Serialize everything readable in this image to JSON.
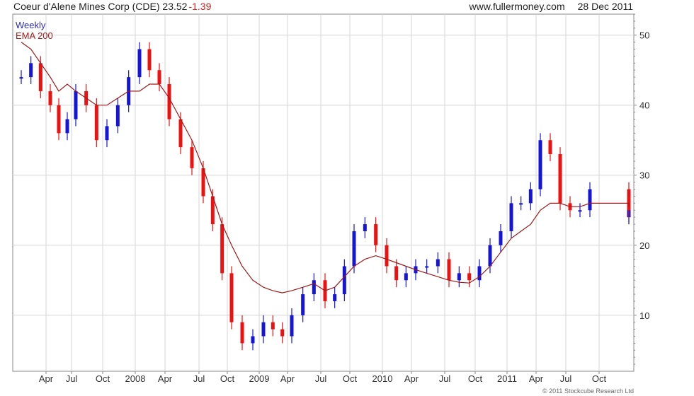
{
  "header": {
    "title": "Coeur d'Alene Mines Corp (CDE) 23.52",
    "change": "-1.39",
    "site": "www.fullermoney.com",
    "date": "28 Dec 2011"
  },
  "footer": "© 2011 Stockcube Research Ltd",
  "colors": {
    "up": "#1515d8",
    "down": "#ee1111",
    "ema": "#a01818",
    "grid": "#d6d6d6",
    "axis": "#888888"
  },
  "chart_data": {
    "type": "line",
    "title": "Coeur d'Alene Mines Corp (CDE) 23.52 -1.39",
    "xlabel": "",
    "ylabel": "",
    "ylim": [
      2,
      53
    ],
    "grid": true,
    "legend_placement": "top-left",
    "x_ticks": [
      "Apr",
      "Jul",
      "Oct",
      "2008",
      "Apr",
      "Jul",
      "Oct",
      "2009",
      "Apr",
      "Jul",
      "Oct",
      "2010",
      "Apr",
      "Jul",
      "Oct",
      "2011",
      "Apr",
      "Jul",
      "Oct"
    ],
    "y_ticks": [
      10,
      20,
      30,
      40,
      50
    ],
    "series": [
      {
        "name": "Weekly",
        "style": "bars",
        "x": [
          "2007-01",
          "2007-02",
          "2007-03",
          "2007-04",
          "2007-05",
          "2007-06",
          "2007-07",
          "2007-08",
          "2007-09",
          "2007-10",
          "2007-11",
          "2007-12",
          "2008-01",
          "2008-02",
          "2008-03",
          "2008-04",
          "2008-05",
          "2008-06",
          "2008-07",
          "2008-08",
          "2008-09",
          "2008-10",
          "2008-11",
          "2008-12",
          "2009-01",
          "2009-02",
          "2009-03",
          "2009-04",
          "2009-05",
          "2009-06",
          "2009-07",
          "2009-08",
          "2009-09",
          "2009-10",
          "2009-11",
          "2009-12",
          "2010-01",
          "2010-02",
          "2010-03",
          "2010-04",
          "2010-05",
          "2010-06",
          "2010-07",
          "2010-08",
          "2010-09",
          "2010-10",
          "2010-11",
          "2010-12",
          "2011-01",
          "2011-02",
          "2011-03",
          "2011-04",
          "2011-05",
          "2011-06",
          "2011-07",
          "2011-08",
          "2011-09",
          "2011-10",
          "2011-11",
          "2011-12"
        ],
        "values": [
          44,
          46,
          42,
          40,
          36,
          38,
          42,
          40,
          35,
          37,
          40,
          44,
          48,
          45,
          43,
          38,
          34,
          31,
          27,
          23,
          16,
          9,
          6,
          7,
          9,
          8,
          7,
          10,
          13,
          15,
          12,
          13,
          17,
          22,
          23,
          20,
          17,
          15,
          16,
          17,
          17,
          18,
          15,
          16,
          15,
          17,
          20,
          22,
          26,
          26,
          28,
          35,
          33,
          26,
          25,
          25,
          28,
          24,
          27,
          25
        ]
      },
      {
        "name": "EMA 200",
        "style": "line",
        "x": [
          "2007-01",
          "2007-02",
          "2007-03",
          "2007-04",
          "2007-05",
          "2007-06",
          "2007-07",
          "2007-08",
          "2007-09",
          "2007-10",
          "2007-11",
          "2007-12",
          "2008-01",
          "2008-02",
          "2008-03",
          "2008-04",
          "2008-05",
          "2008-06",
          "2008-07",
          "2008-08",
          "2008-09",
          "2008-10",
          "2008-11",
          "2008-12",
          "2009-01",
          "2009-02",
          "2009-03",
          "2009-04",
          "2009-05",
          "2009-06",
          "2009-07",
          "2009-08",
          "2009-09",
          "2009-10",
          "2009-11",
          "2009-12",
          "2010-01",
          "2010-02",
          "2010-03",
          "2010-04",
          "2010-05",
          "2010-06",
          "2010-07",
          "2010-08",
          "2010-09",
          "2010-10",
          "2010-11",
          "2010-12",
          "2011-01",
          "2011-02",
          "2011-03",
          "2011-04",
          "2011-05",
          "2011-06",
          "2011-07",
          "2011-08",
          "2011-09",
          "2011-10",
          "2011-11",
          "2011-12"
        ],
        "values": [
          49,
          48,
          46,
          44,
          42,
          43,
          42,
          41,
          40,
          40,
          41,
          42,
          42,
          43,
          43,
          41,
          38,
          35,
          31,
          27,
          23,
          20,
          17,
          15,
          14,
          13.5,
          13.2,
          13.5,
          14,
          14.5,
          13.5,
          14,
          15.5,
          17,
          18,
          18.5,
          18,
          17.5,
          17,
          16.5,
          16,
          15.5,
          15,
          14.7,
          14.6,
          15.5,
          17,
          19,
          21,
          22,
          23,
          25,
          26,
          26,
          25.5,
          25.5,
          26,
          26,
          26,
          25.5
        ]
      }
    ]
  }
}
